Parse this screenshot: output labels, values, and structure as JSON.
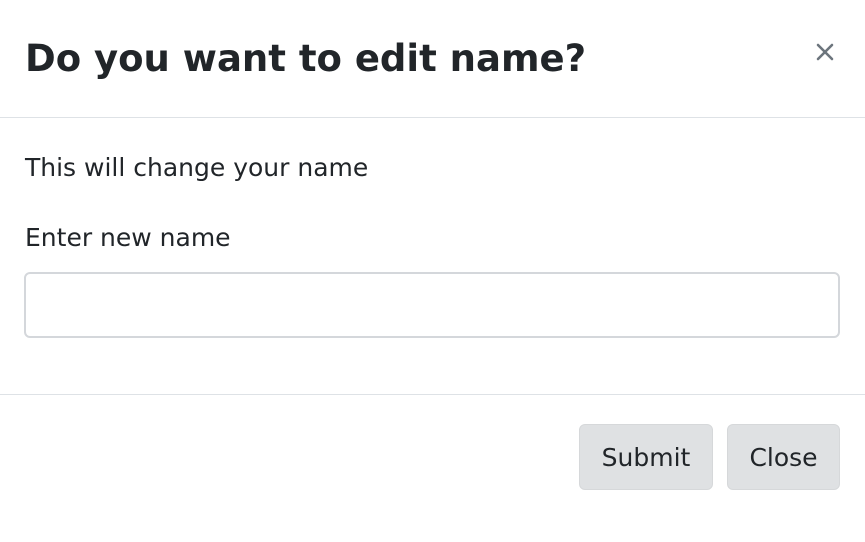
{
  "dialog": {
    "title": "Do you want to edit name?",
    "close_icon": "close-icon",
    "description": "This will change your name",
    "name_field": {
      "label": "Enter new name",
      "value": "",
      "placeholder": ""
    },
    "buttons": {
      "submit_label": "Submit",
      "close_label": "Close"
    }
  },
  "colors": {
    "text": "#212529",
    "divider": "#dee2e6",
    "button_bg": "#dfe1e3",
    "close_icon": "#6c757d"
  }
}
